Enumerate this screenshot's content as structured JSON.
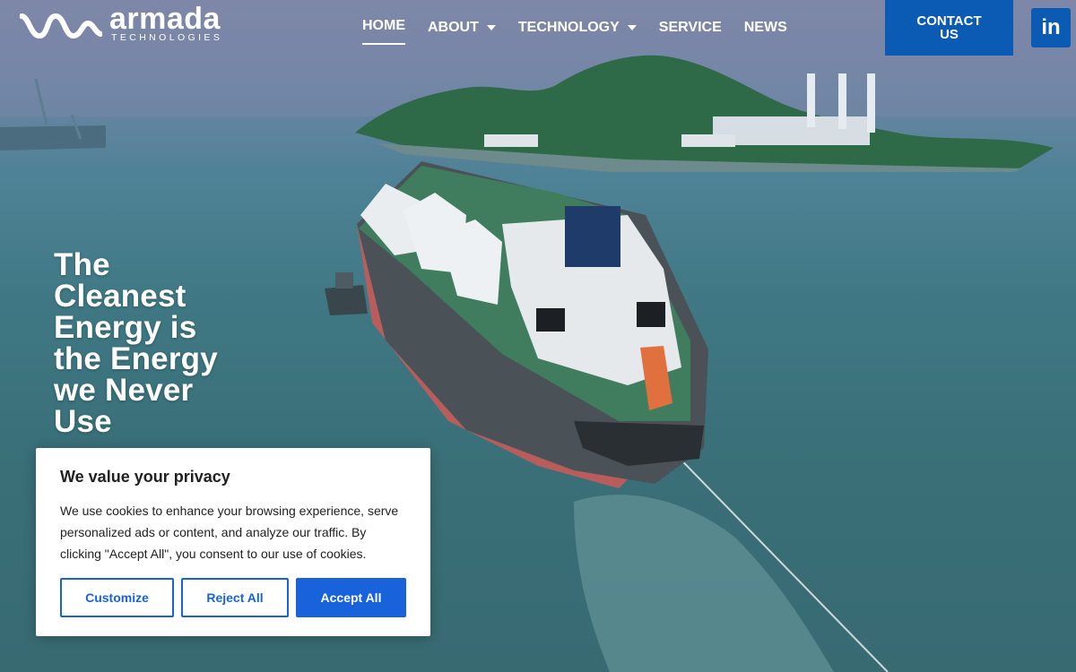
{
  "brand": {
    "name": "armada",
    "tagline": "TECHNOLOGIES"
  },
  "nav": {
    "items": [
      {
        "label": "HOME",
        "active": true,
        "dropdown": false
      },
      {
        "label": "ABOUT",
        "active": false,
        "dropdown": true
      },
      {
        "label": "TECHNOLOGY",
        "active": false,
        "dropdown": true
      },
      {
        "label": "SERVICE",
        "active": false,
        "dropdown": false
      },
      {
        "label": "NEWS",
        "active": false,
        "dropdown": false
      }
    ],
    "contact_label": "CONTACT US",
    "social_icon": "linkedin-icon",
    "social_label": "in"
  },
  "hero": {
    "headline": "The Cleanest Energy is the Energy we Never Use"
  },
  "cookie": {
    "title": "We value your privacy",
    "text": "We use cookies to enhance your browsing experience, serve personalized ads or content, and analyze our traffic. By clicking \"Accept All\", you consent to our use of cookies.",
    "customize_label": "Customize",
    "reject_label": "Reject All",
    "accept_label": "Accept All"
  },
  "colors": {
    "accent": "#0b5bb5",
    "cookie_accent": "#1863dc"
  }
}
